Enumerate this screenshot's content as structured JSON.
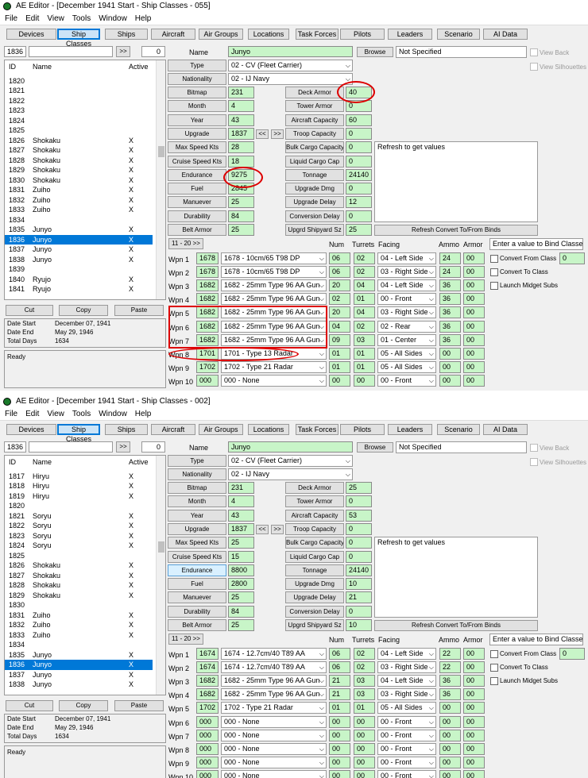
{
  "windows": [
    {
      "title": "AE Editor - [December 1941 Start - Ship Classes - 055]",
      "menu": [
        "File",
        "Edit",
        "View",
        "Tools",
        "Window",
        "Help"
      ],
      "tabs": [
        "Devices",
        "Ship Classes",
        "Ships",
        "Aircraft",
        "Air Groups",
        "Locations",
        "Task Forces",
        "Pilots",
        "Leaders",
        "Scenario",
        "AI Data"
      ],
      "search": {
        "id": "1836",
        "value": "",
        "go": ">>",
        "count": "0"
      },
      "list_headers": {
        "id": "ID",
        "name": "Name",
        "active": "Active"
      },
      "rows": [
        {
          "id": "1820",
          "name": "",
          "active": ""
        },
        {
          "id": "1821",
          "name": "",
          "active": ""
        },
        {
          "id": "1822",
          "name": "",
          "active": ""
        },
        {
          "id": "1823",
          "name": "",
          "active": ""
        },
        {
          "id": "1824",
          "name": "",
          "active": ""
        },
        {
          "id": "1825",
          "name": "",
          "active": ""
        },
        {
          "id": "1826",
          "name": "Shokaku",
          "active": "X"
        },
        {
          "id": "1827",
          "name": "Shokaku",
          "active": "X"
        },
        {
          "id": "1828",
          "name": "Shokaku",
          "active": "X"
        },
        {
          "id": "1829",
          "name": "Shokaku",
          "active": "X"
        },
        {
          "id": "1830",
          "name": "Shokaku",
          "active": "X"
        },
        {
          "id": "1831",
          "name": "Zuiho",
          "active": "X"
        },
        {
          "id": "1832",
          "name": "Zuiho",
          "active": "X"
        },
        {
          "id": "1833",
          "name": "Zuiho",
          "active": "X"
        },
        {
          "id": "1834",
          "name": "",
          "active": ""
        },
        {
          "id": "1835",
          "name": "Junyo",
          "active": "X"
        },
        {
          "id": "1836",
          "name": "Junyo",
          "active": "X",
          "selected": true
        },
        {
          "id": "1837",
          "name": "Junyo",
          "active": "X"
        },
        {
          "id": "1838",
          "name": "Junyo",
          "active": "X"
        },
        {
          "id": "1839",
          "name": "",
          "active": ""
        },
        {
          "id": "1840",
          "name": "Ryujo",
          "active": "X"
        },
        {
          "id": "1841",
          "name": "Ryujo",
          "active": "X"
        }
      ],
      "clip_buttons": [
        "Cut",
        "Copy",
        "Paste"
      ],
      "dates": {
        "start_label": "Date Start",
        "start": "December 07, 1941",
        "end_label": "Date End",
        "end": "May 29, 1946",
        "total_label": "Total Days",
        "total": "1634"
      },
      "status": "Ready",
      "name_label": "Name",
      "name": "Junyo",
      "browse": "Browse",
      "not_specified": "Not Specified",
      "view_back": "View Back",
      "view_silhouettes": "View Silhouettes",
      "type_label": "Type",
      "type": "02 - CV (Fleet Carrier)",
      "nationality_label": "Nationality",
      "nationality": "02 - IJ Navy",
      "left_fields": [
        {
          "label": "Bitmap",
          "value": "231"
        },
        {
          "label": "Month",
          "value": "4"
        },
        {
          "label": "Year",
          "value": "43"
        },
        {
          "label": "Upgrade",
          "value": "1837"
        },
        {
          "label": "Max Speed Kts",
          "value": "28"
        },
        {
          "label": "Cruise Speed Kts",
          "value": "18"
        },
        {
          "label": "Endurance",
          "value": "9275"
        },
        {
          "label": "Fuel",
          "value": "2845"
        },
        {
          "label": "Manuever",
          "value": "25"
        },
        {
          "label": "Durability",
          "value": "84"
        },
        {
          "label": "Belt Armor",
          "value": "25"
        }
      ],
      "upgrade_prev": "<<",
      "upgrade_next": ">>",
      "right_fields": [
        {
          "label": "Deck Armor",
          "value": "40"
        },
        {
          "label": "Tower Armor",
          "value": "0"
        },
        {
          "label": "Aircraft Capacity",
          "value": "60"
        },
        {
          "label": "Troop Capacity",
          "value": "0"
        },
        {
          "label": "Bulk Cargo Capacity",
          "value": "0"
        },
        {
          "label": "Liquid Cargo Cap",
          "value": "0"
        },
        {
          "label": "Tonnage",
          "value": "24140"
        },
        {
          "label": "Upgrade Dmg",
          "value": "0"
        },
        {
          "label": "Upgrade Delay",
          "value": "12"
        },
        {
          "label": "Conversion Delay",
          "value": "0"
        },
        {
          "label": "Upgrd Shipyard Sz",
          "value": "25"
        }
      ],
      "refresh_text": "Refresh to get values",
      "refresh_btn": "Refresh Convert To/From Binds",
      "wpn_page_btn": "11 - 20 >>",
      "wpn_headers": {
        "num": "Num",
        "turrets": "Turrets",
        "facing": "Facing",
        "ammo": "Ammo",
        "armor": "Armor"
      },
      "bind_label": "Enter a value to Bind Classes",
      "convert_from": "Convert From Class",
      "convert_from_value": "0",
      "convert_to": "Convert To Class",
      "launch_midget": "Launch Midget Subs",
      "weapons": [
        {
          "label": "Wpn 1",
          "id": "1678",
          "name": "1678 - 10cm/65 T98 DP",
          "num": "06",
          "turrets": "02",
          "facing": "04 - Left Side",
          "ammo": "24",
          "armor": "00"
        },
        {
          "label": "Wpn 2",
          "id": "1678",
          "name": "1678 - 10cm/65 T98 DP",
          "num": "06",
          "turrets": "02",
          "facing": "03 - Right Side",
          "ammo": "24",
          "armor": "00"
        },
        {
          "label": "Wpn 3",
          "id": "1682",
          "name": "1682 - 25mm Type 96 AA Gun",
          "num": "20",
          "turrets": "04",
          "facing": "04 - Left Side",
          "ammo": "36",
          "armor": "00"
        },
        {
          "label": "Wpn 4",
          "id": "1682",
          "name": "1682 - 25mm Type 96 AA Gun",
          "num": "02",
          "turrets": "01",
          "facing": "00 - Front",
          "ammo": "36",
          "armor": "00"
        },
        {
          "label": "Wpn 5",
          "id": "1682",
          "name": "1682 - 25mm Type 96 AA Gun",
          "num": "20",
          "turrets": "04",
          "facing": "03 - Right Side",
          "ammo": "36",
          "armor": "00"
        },
        {
          "label": "Wpn 6",
          "id": "1682",
          "name": "1682 - 25mm Type 96 AA Gun",
          "num": "04",
          "turrets": "02",
          "facing": "02 - Rear",
          "ammo": "36",
          "armor": "00"
        },
        {
          "label": "Wpn 7",
          "id": "1682",
          "name": "1682 - 25mm Type 96 AA Gun",
          "num": "09",
          "turrets": "03",
          "facing": "01 - Center",
          "ammo": "36",
          "armor": "00"
        },
        {
          "label": "Wpn 8",
          "id": "1701",
          "name": "1701 - Type 13 Radar",
          "num": "01",
          "turrets": "01",
          "facing": "05 - All Sides",
          "ammo": "00",
          "armor": "00"
        },
        {
          "label": "Wpn 9",
          "id": "1702",
          "name": "1702 - Type 21 Radar",
          "num": "01",
          "turrets": "01",
          "facing": "05 - All Sides",
          "ammo": "00",
          "armor": "00"
        },
        {
          "label": "Wpn 10",
          "id": "000",
          "name": "000 - None",
          "num": "00",
          "turrets": "00",
          "facing": "00 - Front",
          "ammo": "00",
          "armor": "00"
        }
      ]
    },
    {
      "title": "AE Editor - [December 1941 Start - Ship Classes - 002]",
      "menu": [
        "File",
        "Edit",
        "View",
        "Tools",
        "Window",
        "Help"
      ],
      "tabs": [
        "Devices",
        "Ship Classes",
        "Ships",
        "Aircraft",
        "Air Groups",
        "Locations",
        "Task Forces",
        "Pilots",
        "Leaders",
        "Scenario",
        "AI Data"
      ],
      "search": {
        "id": "1836",
        "value": "",
        "go": ">>",
        "count": "0"
      },
      "list_headers": {
        "id": "ID",
        "name": "Name",
        "active": "Active"
      },
      "rows": [
        {
          "id": "1817",
          "name": "Hiryu",
          "active": "X"
        },
        {
          "id": "1818",
          "name": "Hiryu",
          "active": "X"
        },
        {
          "id": "1819",
          "name": "Hiryu",
          "active": "X"
        },
        {
          "id": "1820",
          "name": "",
          "active": ""
        },
        {
          "id": "1821",
          "name": "Soryu",
          "active": "X"
        },
        {
          "id": "1822",
          "name": "Soryu",
          "active": "X"
        },
        {
          "id": "1823",
          "name": "Soryu",
          "active": "X"
        },
        {
          "id": "1824",
          "name": "Soryu",
          "active": "X"
        },
        {
          "id": "1825",
          "name": "",
          "active": ""
        },
        {
          "id": "1826",
          "name": "Shokaku",
          "active": "X"
        },
        {
          "id": "1827",
          "name": "Shokaku",
          "active": "X"
        },
        {
          "id": "1828",
          "name": "Shokaku",
          "active": "X"
        },
        {
          "id": "1829",
          "name": "Shokaku",
          "active": "X"
        },
        {
          "id": "1830",
          "name": "",
          "active": ""
        },
        {
          "id": "1831",
          "name": "Zuiho",
          "active": "X"
        },
        {
          "id": "1832",
          "name": "Zuiho",
          "active": "X"
        },
        {
          "id": "1833",
          "name": "Zuiho",
          "active": "X"
        },
        {
          "id": "1834",
          "name": "",
          "active": ""
        },
        {
          "id": "1835",
          "name": "Junyo",
          "active": "X"
        },
        {
          "id": "1836",
          "name": "Junyo",
          "active": "X",
          "selected": true
        },
        {
          "id": "1837",
          "name": "Junyo",
          "active": "X"
        },
        {
          "id": "1838",
          "name": "Junyo",
          "active": "X"
        }
      ],
      "clip_buttons": [
        "Cut",
        "Copy",
        "Paste"
      ],
      "dates": {
        "start_label": "Date Start",
        "start": "December 07, 1941",
        "end_label": "Date End",
        "end": "May 29, 1946",
        "total_label": "Total Days",
        "total": "1634"
      },
      "status": "Ready",
      "name_label": "Name",
      "name": "Junyo",
      "browse": "Browse",
      "not_specified": "Not Specified",
      "view_back": "View Back",
      "view_silhouettes": "View Silhouettes",
      "type_label": "Type",
      "type": "02 - CV (Fleet Carrier)",
      "nationality_label": "Nationality",
      "nationality": "02 - IJ Navy",
      "left_fields": [
        {
          "label": "Bitmap",
          "value": "231"
        },
        {
          "label": "Month",
          "value": "4"
        },
        {
          "label": "Year",
          "value": "43"
        },
        {
          "label": "Upgrade",
          "value": "1837"
        },
        {
          "label": "Max Speed Kts",
          "value": "25"
        },
        {
          "label": "Cruise Speed Kts",
          "value": "15"
        },
        {
          "label": "Endurance",
          "value": "8800"
        },
        {
          "label": "Fuel",
          "value": "2800"
        },
        {
          "label": "Manuever",
          "value": "25"
        },
        {
          "label": "Durability",
          "value": "84"
        },
        {
          "label": "Belt Armor",
          "value": "25"
        }
      ],
      "upgrade_prev": "<<",
      "upgrade_next": ">>",
      "right_fields": [
        {
          "label": "Deck Armor",
          "value": "25"
        },
        {
          "label": "Tower Armor",
          "value": "0"
        },
        {
          "label": "Aircraft Capacity",
          "value": "53"
        },
        {
          "label": "Troop Capacity",
          "value": "0"
        },
        {
          "label": "Bulk Cargo Capacity",
          "value": "0"
        },
        {
          "label": "Liquid Cargo Cap",
          "value": "0"
        },
        {
          "label": "Tonnage",
          "value": "24140"
        },
        {
          "label": "Upgrade Dmg",
          "value": "10"
        },
        {
          "label": "Upgrade Delay",
          "value": "21"
        },
        {
          "label": "Conversion Delay",
          "value": "0"
        },
        {
          "label": "Upgrd Shipyard Sz",
          "value": "10"
        }
      ],
      "refresh_text": "Refresh to get values",
      "refresh_btn": "Refresh Convert To/From Binds",
      "wpn_page_btn": "11 - 20 >>",
      "wpn_headers": {
        "num": "Num",
        "turrets": "Turrets",
        "facing": "Facing",
        "ammo": "Ammo",
        "armor": "Armor"
      },
      "bind_label": "Enter a value to Bind Classes",
      "convert_from": "Convert From Class",
      "convert_from_value": "0",
      "convert_to": "Convert To Class",
      "launch_midget": "Launch Midget Subs",
      "weapons": [
        {
          "label": "Wpn 1",
          "id": "1674",
          "name": "1674 - 12.7cm/40 T89 AA",
          "num": "06",
          "turrets": "02",
          "facing": "04 - Left Side",
          "ammo": "22",
          "armor": "00"
        },
        {
          "label": "Wpn 2",
          "id": "1674",
          "name": "1674 - 12.7cm/40 T89 AA",
          "num": "06",
          "turrets": "02",
          "facing": "03 - Right Side",
          "ammo": "22",
          "armor": "00"
        },
        {
          "label": "Wpn 3",
          "id": "1682",
          "name": "1682 - 25mm Type 96 AA Gun",
          "num": "21",
          "turrets": "03",
          "facing": "04 - Left Side",
          "ammo": "36",
          "armor": "00"
        },
        {
          "label": "Wpn 4",
          "id": "1682",
          "name": "1682 - 25mm Type 96 AA Gun",
          "num": "21",
          "turrets": "03",
          "facing": "03 - Right Side",
          "ammo": "36",
          "armor": "00"
        },
        {
          "label": "Wpn 5",
          "id": "1702",
          "name": "1702 - Type 21 Radar",
          "num": "01",
          "turrets": "01",
          "facing": "05 - All Sides",
          "ammo": "00",
          "armor": "00"
        },
        {
          "label": "Wpn 6",
          "id": "000",
          "name": "000 - None",
          "num": "00",
          "turrets": "00",
          "facing": "00 - Front",
          "ammo": "00",
          "armor": "00"
        },
        {
          "label": "Wpn 7",
          "id": "000",
          "name": "000 - None",
          "num": "00",
          "turrets": "00",
          "facing": "00 - Front",
          "ammo": "00",
          "armor": "00"
        },
        {
          "label": "Wpn 8",
          "id": "000",
          "name": "000 - None",
          "num": "00",
          "turrets": "00",
          "facing": "00 - Front",
          "ammo": "00",
          "armor": "00"
        },
        {
          "label": "Wpn 9",
          "id": "000",
          "name": "000 - None",
          "num": "00",
          "turrets": "00",
          "facing": "00 - Front",
          "ammo": "00",
          "armor": "00"
        },
        {
          "label": "Wpn 10",
          "id": "000",
          "name": "000 - None",
          "num": "00",
          "turrets": "00",
          "facing": "00 - Front",
          "ammo": "00",
          "armor": "00"
        }
      ]
    }
  ],
  "colors": {
    "field_green": "#c8f5c8",
    "selection_blue": "#0078d7",
    "highlight_red": "#d00000"
  }
}
